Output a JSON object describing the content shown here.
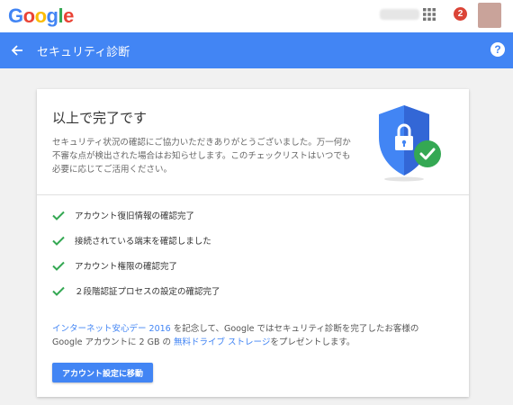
{
  "header": {
    "logo": {
      "text": "Google",
      "letters": [
        {
          "char": "G",
          "color": "#4285f4"
        },
        {
          "char": "o",
          "color": "#ea4335"
        },
        {
          "char": "o",
          "color": "#fbbc05"
        },
        {
          "char": "g",
          "color": "#4285f4"
        },
        {
          "char": "l",
          "color": "#34a853"
        },
        {
          "char": "e",
          "color": "#ea4335"
        }
      ]
    },
    "notification_count": "2",
    "icons": {
      "apps": "apps-grid-icon",
      "avatar": "user-avatar"
    }
  },
  "nav": {
    "title": "セキュリティ診断",
    "back_icon": "arrow-back-icon",
    "help_icon": "help-icon",
    "help_glyph": "?"
  },
  "card": {
    "title": "以上で完了です",
    "description": "セキュリティ状況の確認にご協力いただきありがとうございました。万一何か不審な点が検出された場合はお知らせします。このチェックリストはいつでも必要に応じてご活用ください。",
    "shield_icon": "shield-lock-check-icon",
    "checklist": [
      {
        "label": "アカウント復旧情報の確認完了"
      },
      {
        "label": "接続されている端末を確認しました"
      },
      {
        "label": "アカウント権限の確認完了"
      },
      {
        "label": "２段階認証プロセスの設定の確認完了"
      }
    ],
    "promo": {
      "link1": "インターネット安心デー 2016",
      "text1": " を記念して、Google ではセキュリティ診断を完了したお客様の Google アカウントに 2 GB の ",
      "link2": "無料ドライブ ストレージ",
      "text2": "をプレゼントします。"
    },
    "button_label": "アカウント設定に移動"
  },
  "colors": {
    "brand_blue": "#4285f4",
    "check_green": "#34a853",
    "badge_red": "#db4437"
  }
}
